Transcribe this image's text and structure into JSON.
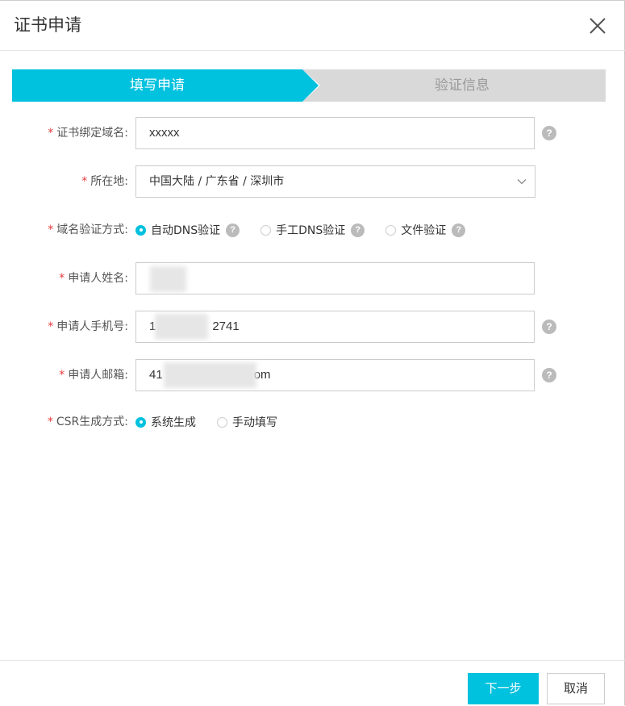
{
  "dialog": {
    "title": "证书申请"
  },
  "steps": [
    {
      "label": "填写申请"
    },
    {
      "label": "验证信息"
    }
  ],
  "form": {
    "domain": {
      "label": "证书绑定域名:",
      "value": "xxxxx"
    },
    "location": {
      "label": "所在地:",
      "value": "中国大陆 / 广东省 / 深圳市"
    },
    "verify_method": {
      "label": "域名验证方式:",
      "options": [
        {
          "label": "自动DNS验证",
          "selected": true
        },
        {
          "label": "手工DNS验证",
          "selected": false
        },
        {
          "label": "文件验证",
          "selected": false
        }
      ]
    },
    "name": {
      "label": "申请人姓名:",
      "value": ""
    },
    "phone": {
      "label": "申请人手机号:",
      "value_start": "1",
      "value_end": "2741"
    },
    "email": {
      "label": "申请人邮箱:",
      "value_start": "41",
      "value_end": "om"
    },
    "csr": {
      "label": "CSR生成方式:",
      "options": [
        {
          "label": "系统生成",
          "selected": true
        },
        {
          "label": "手动填写",
          "selected": false
        }
      ]
    }
  },
  "required_mark": "*",
  "help_glyph": "?",
  "footer": {
    "next_label": "下一步",
    "cancel_label": "取消"
  },
  "colors": {
    "accent": "#00c1de",
    "required": "#e4393c",
    "step_inactive": "#d9d9d9"
  }
}
